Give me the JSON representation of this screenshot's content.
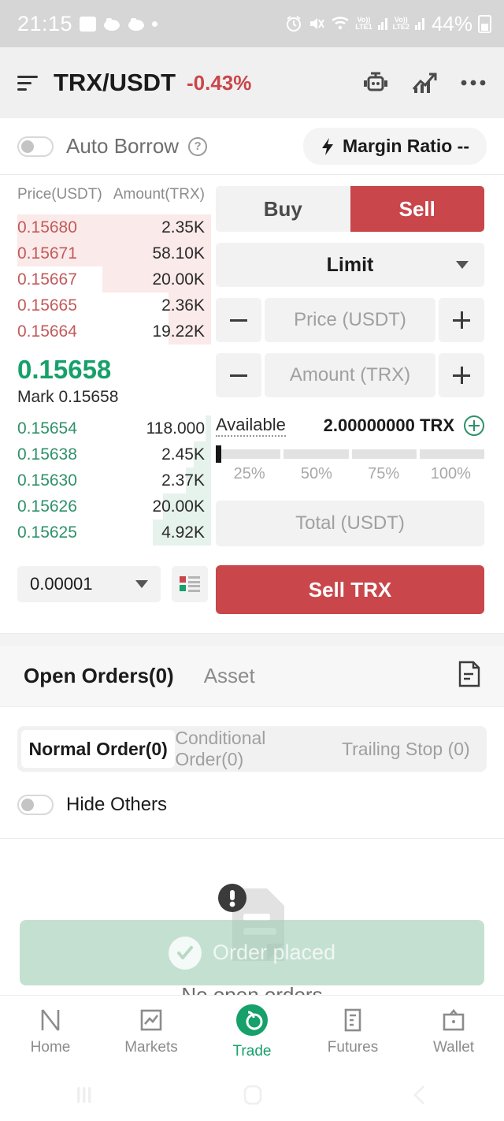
{
  "status_bar": {
    "time": "21:15",
    "battery_percent": "44%",
    "icons": [
      "image-icon",
      "game-controller-icon",
      "game-controller-icon",
      "dot-icon",
      "alarm-icon",
      "mute-icon",
      "wifi-icon",
      "volte-lte1-icon",
      "signal-bars-icon",
      "volte-lte2-icon",
      "signal-bars-icon",
      "battery-icon"
    ],
    "lte1_label": "LTE1",
    "lte2_label": "LTE2",
    "volte_label": "Vo))"
  },
  "header": {
    "pair": "TRX/USDT",
    "change_pct": "-0.43%",
    "change_color": "#c9464a",
    "icons": [
      "menu-icon",
      "bot-icon",
      "chart-trend-icon",
      "more-options-icon"
    ]
  },
  "margin_bar": {
    "auto_borrow_label": "Auto Borrow",
    "auto_borrow_on": false,
    "help_glyph": "?",
    "margin_ratio_label": "Margin Ratio --"
  },
  "order_book": {
    "price_header": "Price(USDT)",
    "amount_header": "Amount(TRX)",
    "asks": [
      {
        "price": "0.15680",
        "amount": "2.35K",
        "depth_pct": 100
      },
      {
        "price": "0.15671",
        "amount": "58.10K",
        "depth_pct": 100
      },
      {
        "price": "0.15667",
        "amount": "20.00K",
        "depth_pct": 56
      },
      {
        "price": "0.15665",
        "amount": "2.36K",
        "depth_pct": 22
      },
      {
        "price": "0.15664",
        "amount": "19.22K",
        "depth_pct": 22
      }
    ],
    "last_price": "0.15658",
    "mark_label": "Mark 0.15658",
    "bids": [
      {
        "price": "0.15654",
        "amount": "118.000",
        "depth_pct": 3
      },
      {
        "price": "0.15638",
        "amount": "2.45K",
        "depth_pct": 9
      },
      {
        "price": "0.15630",
        "amount": "2.37K",
        "depth_pct": 13
      },
      {
        "price": "0.15626",
        "amount": "20.00K",
        "depth_pct": 25
      },
      {
        "price": "0.15625",
        "amount": "4.92K",
        "depth_pct": 30
      }
    ],
    "ask_color": "#c35a5a",
    "bid_color": "#2f9169",
    "last_price_color": "#16a06a",
    "tick_size": "0.00001",
    "depth_view_icon": "order-book-layout-icon"
  },
  "order_form": {
    "buy_label": "Buy",
    "sell_label": "Sell",
    "active_side": "Sell",
    "order_type": "Limit",
    "price_placeholder": "Price (USDT)",
    "price_value": "",
    "amount_placeholder": "Amount (TRX)",
    "amount_value": "",
    "available_label": "Available",
    "available_value": "2.00000000 TRX",
    "slider_percent": 0,
    "slider_marks": [
      "25%",
      "50%",
      "75%",
      "100%"
    ],
    "total_placeholder": "Total (USDT)",
    "total_value": "",
    "submit_label": "Sell TRX",
    "submit_color": "#c9464a"
  },
  "orders": {
    "tabs": [
      {
        "label": "Open Orders(0)",
        "active": true
      },
      {
        "label": "Asset",
        "active": false
      }
    ],
    "doc_icon": "document-icon",
    "subtabs": [
      {
        "label": "Normal Order(0)",
        "active": true
      },
      {
        "label": "Conditional Order(0)",
        "active": false
      },
      {
        "label": "Trailing Stop (0)",
        "active": false
      }
    ],
    "hide_others_label": "Hide Others",
    "hide_others_on": false,
    "empty_text": "No open orders",
    "empty_icon": "empty-document-alert-icon"
  },
  "toast": {
    "message": "Order placed",
    "icon": "check-circle-icon",
    "background": "#a0cdb4"
  },
  "bottom_nav": [
    {
      "label": "Home",
      "icon": "home-icon",
      "active": false
    },
    {
      "label": "Markets",
      "icon": "markets-icon",
      "active": false
    },
    {
      "label": "Trade",
      "icon": "trade-icon",
      "active": true
    },
    {
      "label": "Futures",
      "icon": "futures-icon",
      "active": false
    },
    {
      "label": "Wallet",
      "icon": "wallet-icon",
      "active": false
    }
  ],
  "system_nav": [
    "recents-icon",
    "home-button-icon",
    "back-icon"
  ]
}
